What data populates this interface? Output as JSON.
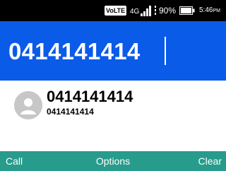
{
  "status_bar": {
    "volte_label": "VoLTE",
    "network_label": "4G",
    "battery_percent": "90%",
    "time": "5:46",
    "time_suffix": "PM",
    "icons": [
      "volte-icon",
      "signal-icon",
      "battery-icon"
    ]
  },
  "dialer": {
    "dialed_number": "0414141414"
  },
  "contact_match": {
    "name": "0414141414",
    "number": "0414141414",
    "avatar_icon": "default-avatar-icon"
  },
  "softkeys": {
    "left": "Call",
    "center": "Options",
    "right": "Clear"
  },
  "colors": {
    "status_bar_bg": "#000000",
    "entry_bg": "#0a5be8",
    "softkey_bg": "#279b8c",
    "avatar_bg": "#c7c7c7"
  }
}
